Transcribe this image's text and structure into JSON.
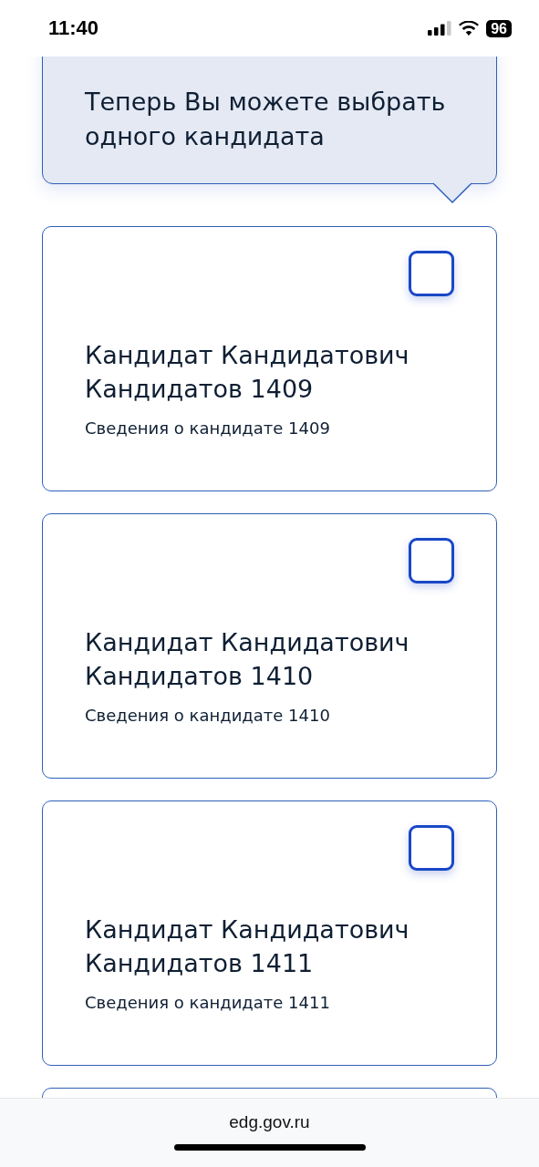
{
  "status_bar": {
    "time": "11:40",
    "battery": "96"
  },
  "hint": {
    "text": "Теперь Вы можете выбрать одного кандидата"
  },
  "candidates": [
    {
      "name": "Кандидат Кандидатович Кандидатов 1409",
      "details": "Сведения о кандидате 1409",
      "checked": false
    },
    {
      "name": "Кандидат Кандидатович Кандидатов 1410",
      "details": "Сведения о кандидате 1410",
      "checked": false
    },
    {
      "name": "Кандидат Кандидатович Кандидатов 1411",
      "details": "Сведения о кандидате 1411",
      "checked": false
    }
  ],
  "browser_bar": {
    "url": "edg.gov.ru"
  }
}
